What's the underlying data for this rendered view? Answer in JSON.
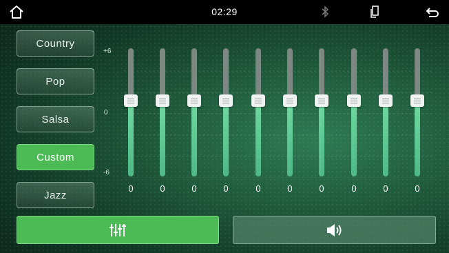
{
  "status_bar": {
    "time": "02:29",
    "icons": [
      "home-icon",
      "bluetooth-icon",
      "phone-link-icon",
      "back-icon"
    ]
  },
  "presets": [
    {
      "label": "Country",
      "active": false
    },
    {
      "label": "Pop",
      "active": false
    },
    {
      "label": "Salsa",
      "active": false
    },
    {
      "label": "Custom",
      "active": true
    },
    {
      "label": "Jazz",
      "active": false
    }
  ],
  "equalizer": {
    "scale": {
      "top": "+6",
      "middle": "0",
      "bottom": "-6"
    },
    "bands": [
      {
        "value": "0"
      },
      {
        "value": "0"
      },
      {
        "value": "0"
      },
      {
        "value": "0"
      },
      {
        "value": "0"
      },
      {
        "value": "0"
      },
      {
        "value": "0"
      },
      {
        "value": "0"
      },
      {
        "value": "0"
      },
      {
        "value": "0"
      }
    ]
  },
  "bottom_buttons": {
    "equalizer_icon": "equalizer-sliders-icon",
    "sound_icon": "speaker-sound-icon"
  },
  "colors": {
    "accent": "#4dbb55",
    "slider_fill": "#5fcb94",
    "status_bar": "#000000"
  }
}
